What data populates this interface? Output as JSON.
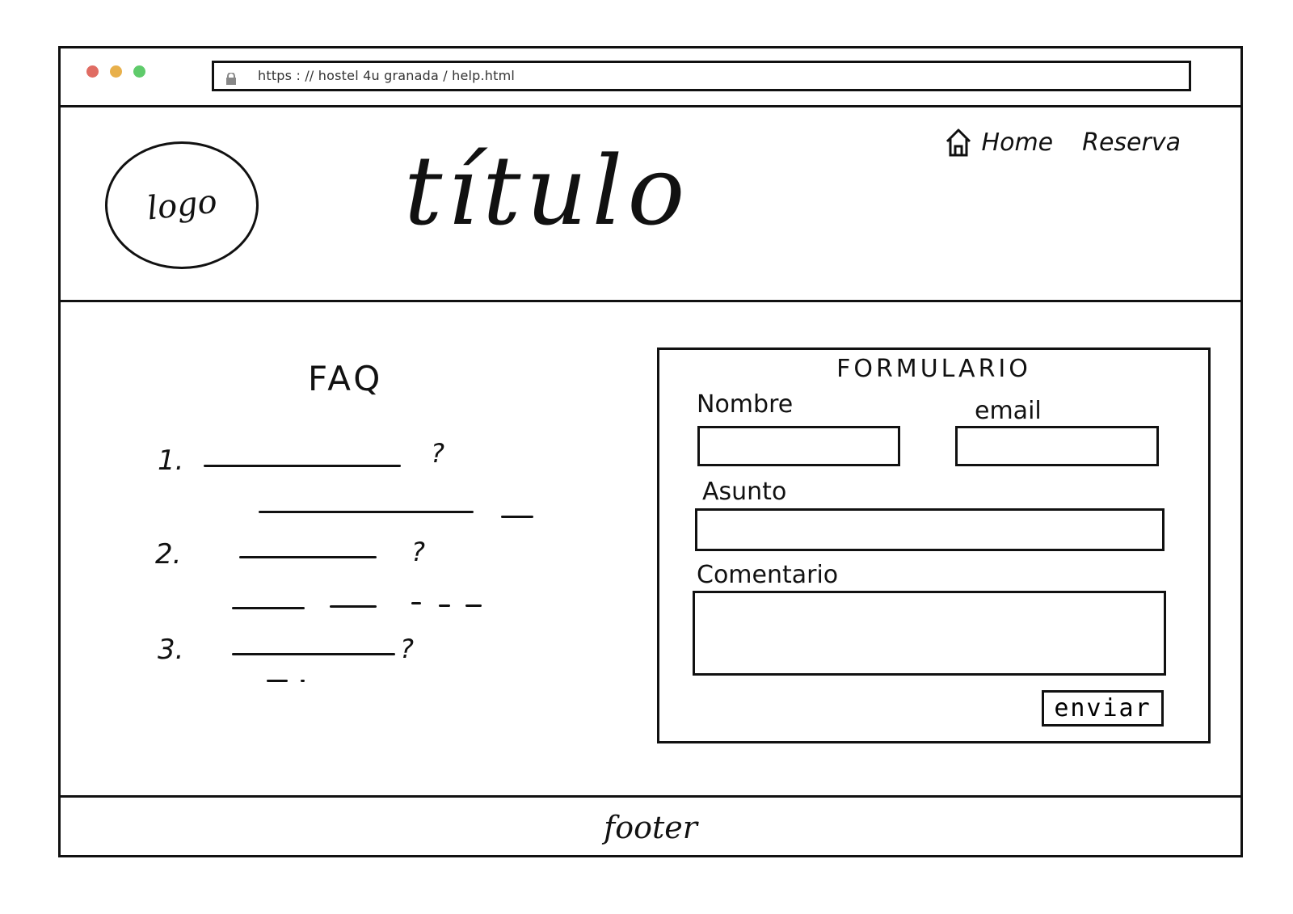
{
  "browser": {
    "url": "https : // hostel 4u granada / help.html",
    "window_dots": [
      "#e06c63",
      "#e8b04b",
      "#5fcb6b"
    ]
  },
  "header": {
    "logo_text": "logo",
    "title": "título",
    "nav": [
      {
        "label": "Home",
        "icon": "home-icon"
      },
      {
        "label": "Reserva"
      }
    ]
  },
  "faq": {
    "title": "FAQ",
    "items": [
      {
        "number": "1.",
        "mark": "?"
      },
      {
        "number": "2.",
        "mark": "?"
      },
      {
        "number": "3.",
        "mark": "?"
      }
    ]
  },
  "form": {
    "title": "FORMULARIO",
    "name_label": "Nombre",
    "email_label": "email",
    "subject_label": "Asunto",
    "comment_label": "Comentario",
    "submit_label": "enviar"
  },
  "footer": {
    "text": "footer"
  }
}
